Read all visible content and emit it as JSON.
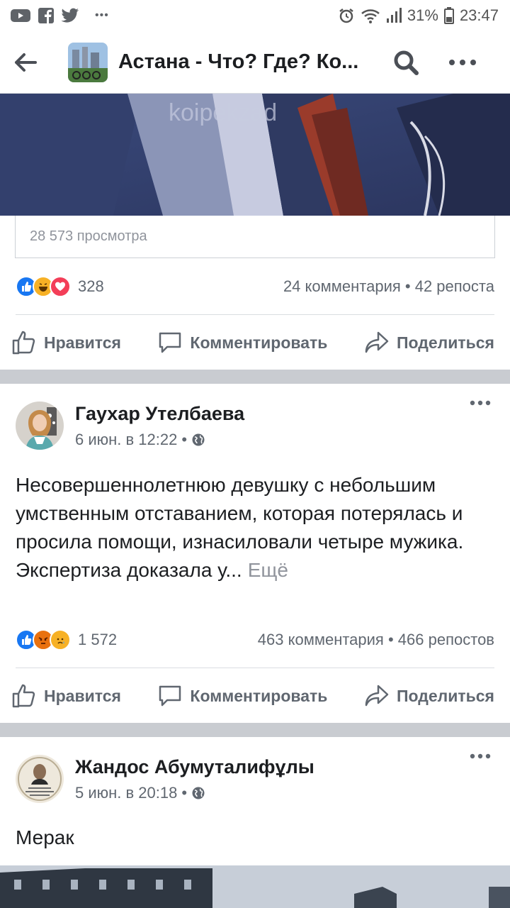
{
  "status_bar": {
    "battery": "31%",
    "time": "23:47",
    "more": "•••"
  },
  "header": {
    "title": "Астана - Что? Где? Ко..."
  },
  "video": {
    "watermark": "koipekzad"
  },
  "post1": {
    "views": "28 573 просмотра",
    "reaction_count": "328",
    "comments": "24 комментария",
    "shares": "42 репоста"
  },
  "actions": {
    "like": "Нравится",
    "comment": "Комментировать",
    "share": "Поделиться"
  },
  "post2": {
    "author": "Гаухар Утелбаева",
    "time": "6 июн. в 12:22",
    "text": "Несовершеннолетнюю девушку с небольшим умственным отставанием, которая потерялась и просила помощи, изнасиловали четыре мужика. Экспертиза доказала у...",
    "see_more": "Ещё",
    "reaction_count": "1 572",
    "comments": "463 комментария",
    "shares": "466 репостов"
  },
  "post3": {
    "author": "Жандос Абумуталифұлы",
    "time": "5 июн. в 20:18",
    "text": "Мерак"
  },
  "colors": {
    "like_blue": "#1877f2",
    "haha_yellow": "#f7b125",
    "love_red": "#f33e58",
    "angry_orange": "#e9710f",
    "separator_gray": "#c9ccd1"
  },
  "icons": [
    "back-arrow-icon",
    "search-icon",
    "more-icon",
    "like-icon",
    "comment-icon",
    "share-icon",
    "globe-icon"
  ]
}
